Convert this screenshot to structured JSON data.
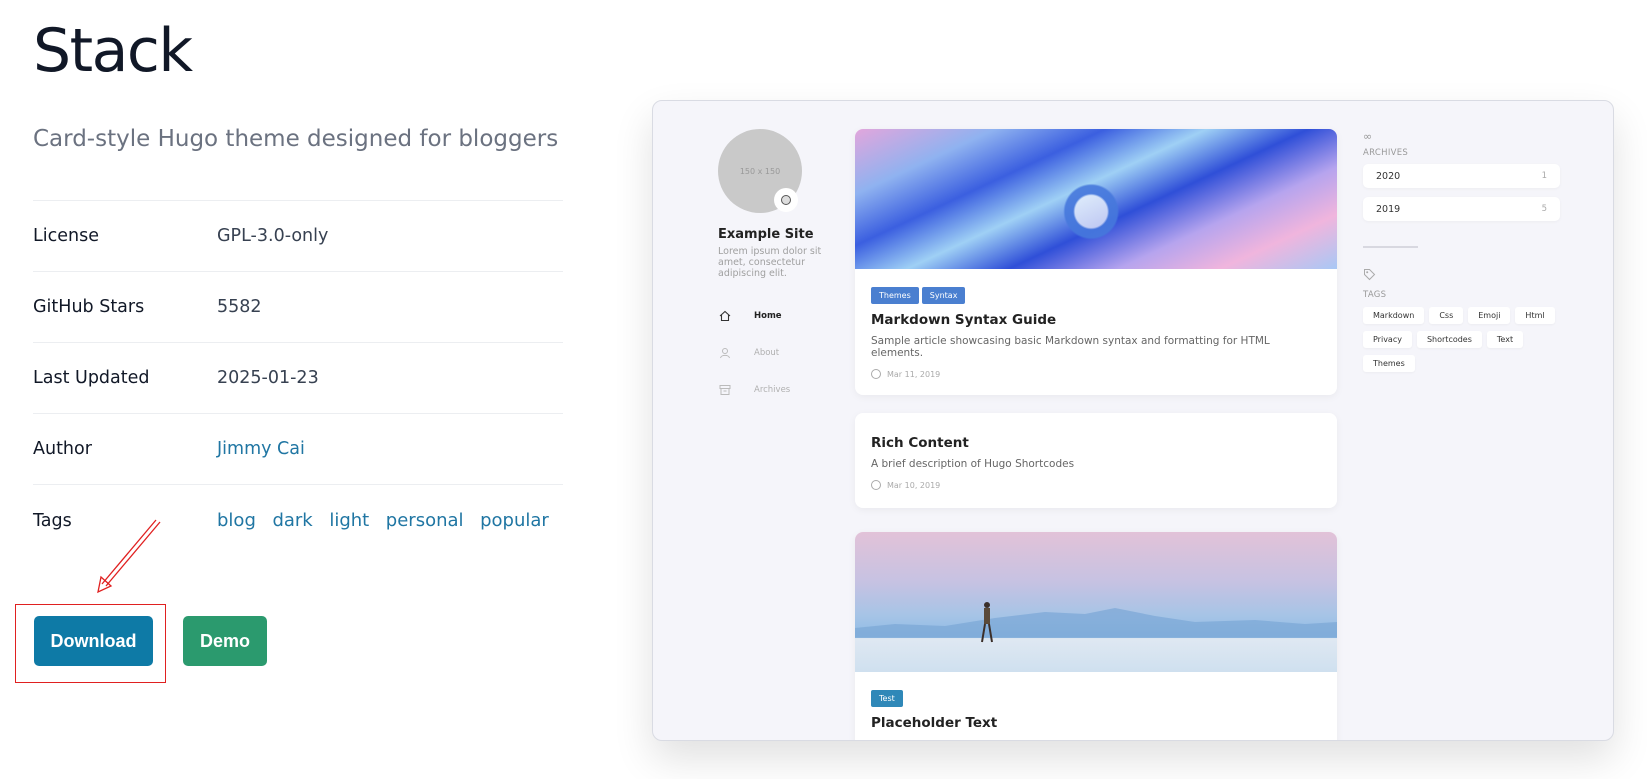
{
  "theme": {
    "title": "Stack",
    "subtitle": "Card-style Hugo theme designed for bloggers"
  },
  "meta": {
    "license_label": "License",
    "license_value": "GPL-3.0-only",
    "stars_label": "GitHub Stars",
    "stars_value": "5582",
    "updated_label": "Last Updated",
    "updated_value": "2025-01-23",
    "author_label": "Author",
    "author_value": "Jimmy Cai",
    "tags_label": "Tags",
    "tags": [
      "blog",
      "dark",
      "light",
      "personal",
      "popular"
    ]
  },
  "buttons": {
    "download": "Download",
    "demo": "Demo"
  },
  "colors": {
    "download": "#0e7aa6",
    "demo": "#2b9a6e",
    "link": "#2076a3",
    "annotation": "#e02020"
  },
  "preview": {
    "avatar_placeholder": "150 x 150",
    "site_name": "Example Site",
    "site_desc": "Lorem ipsum dolor sit amet, consectetur adipiscing elit.",
    "nav": [
      "Home",
      "About",
      "Archives"
    ],
    "posts": [
      {
        "chips": [
          "Themes",
          "Syntax"
        ],
        "title": "Markdown Syntax Guide",
        "desc": "Sample article showcasing basic Markdown syntax and formatting for HTML elements.",
        "date": "Mar 11, 2019"
      },
      {
        "title": "Rich Content",
        "desc": "A brief description of Hugo Shortcodes",
        "date": "Mar 10, 2019"
      },
      {
        "chips": [
          "Test"
        ],
        "title": "Placeholder Text"
      }
    ],
    "archives_heading": "ARCHIVES",
    "archives": [
      {
        "year": "2020",
        "count": "1"
      },
      {
        "year": "2019",
        "count": "5"
      }
    ],
    "tags_heading": "TAGS",
    "tags": [
      "Markdown",
      "Css",
      "Emoji",
      "Html",
      "Privacy",
      "Shortcodes",
      "Text",
      "Themes"
    ]
  }
}
